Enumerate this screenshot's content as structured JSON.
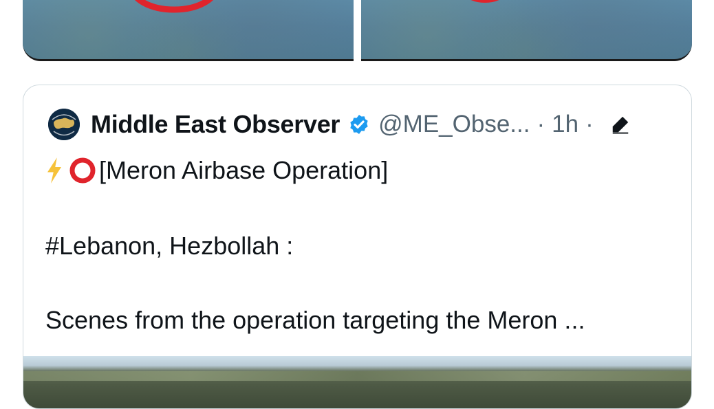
{
  "quote": {
    "author": {
      "display_name": "Middle East Observer",
      "handle": "@ME_Obse...",
      "separator": "·",
      "time": "1h",
      "verified": true,
      "icons": [
        "verified-badge-icon",
        "edit-icon"
      ]
    },
    "text": {
      "line1_title": "[Meron Airbase Operation]",
      "line1_icons": [
        "lightning-icon",
        "red-circle-icon"
      ],
      "line2": "#Lebanon, Hezbollah :",
      "line3": "Scenes from the operation targeting the Meron ..."
    }
  },
  "colors": {
    "verified": "#1d9bf0",
    "secondary_text": "#536471",
    "border": "#cfd9de",
    "marker_red": "#e0242c",
    "bolt": "#f6c23a"
  }
}
